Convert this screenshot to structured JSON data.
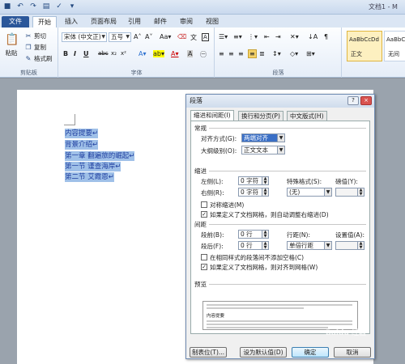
{
  "window": {
    "title": "文档1 - M"
  },
  "quick_access": [
    "save-icon",
    "undo-icon",
    "redo-icon",
    "print-preview-icon",
    "spelling-icon",
    "customize-icon"
  ],
  "tabs": [
    {
      "label": "文件"
    },
    {
      "label": "开始"
    },
    {
      "label": "插入"
    },
    {
      "label": "页面布局"
    },
    {
      "label": "引用"
    },
    {
      "label": "邮件"
    },
    {
      "label": "审阅"
    },
    {
      "label": "视图"
    }
  ],
  "ribbon": {
    "clipboard": {
      "paste": "粘贴",
      "cut": "剪切",
      "copy": "复制",
      "format_painter": "格式刷",
      "label": "剪贴板"
    },
    "font": {
      "font_name": "宋体 (中文正)",
      "font_size": "五号",
      "label": "字体"
    },
    "paragraph": {
      "label": "段落"
    },
    "styles": {
      "items": [
        {
          "sample": "AaBbCcDd",
          "name": "正文"
        },
        {
          "sample": "AaBbCcDd",
          "name": "无间"
        }
      ]
    }
  },
  "document": {
    "lines": [
      "内容提要↵",
      "背景介绍↵",
      "第一章 翻遍旅的崛起↵",
      "第一节 谨查海岸↵",
      "第二节 艾霞恩↵"
    ]
  },
  "dialog": {
    "title": "段落",
    "help": "?",
    "close": "×",
    "tabs": [
      "缩进和间距(I)",
      "换行和分页(P)",
      "中文版式(H)"
    ],
    "general": {
      "heading": "常规",
      "alignment_label": "对齐方式(G):",
      "alignment_value": "两端对齐",
      "outline_label": "大纲级别(O):",
      "outline_value": "正文文本"
    },
    "indent": {
      "heading": "缩进",
      "left_label": "左侧(L):",
      "left_value": "0 字符",
      "right_label": "右侧(R):",
      "right_value": "0 字符",
      "special_label": "特殊格式(S):",
      "special_value": "(无)",
      "by_label": "磅值(Y):",
      "mirror_label": "对称缩进(M)",
      "auto_adjust_label": "如果定义了文档网格，则自动调整右缩进(D)"
    },
    "spacing": {
      "heading": "间距",
      "before_label": "段前(B):",
      "before_value": "0 行",
      "after_label": "段后(F):",
      "after_value": "0 行",
      "line_label": "行距(N):",
      "line_value": "单倍行距",
      "at_label": "设置值(A):",
      "no_space_label": "在相同样式的段落间不添加空格(C)",
      "snap_grid_label": "如果定义了文档网格，则对齐到网格(W)"
    },
    "preview": {
      "heading": "预览",
      "sample": "内容提要"
    },
    "buttons": {
      "tabs": "制表位(T)...",
      "set_default": "设为默认值(D)",
      "ok": "确定",
      "cancel": "取消"
    }
  },
  "watermark": "Baidu 经验"
}
